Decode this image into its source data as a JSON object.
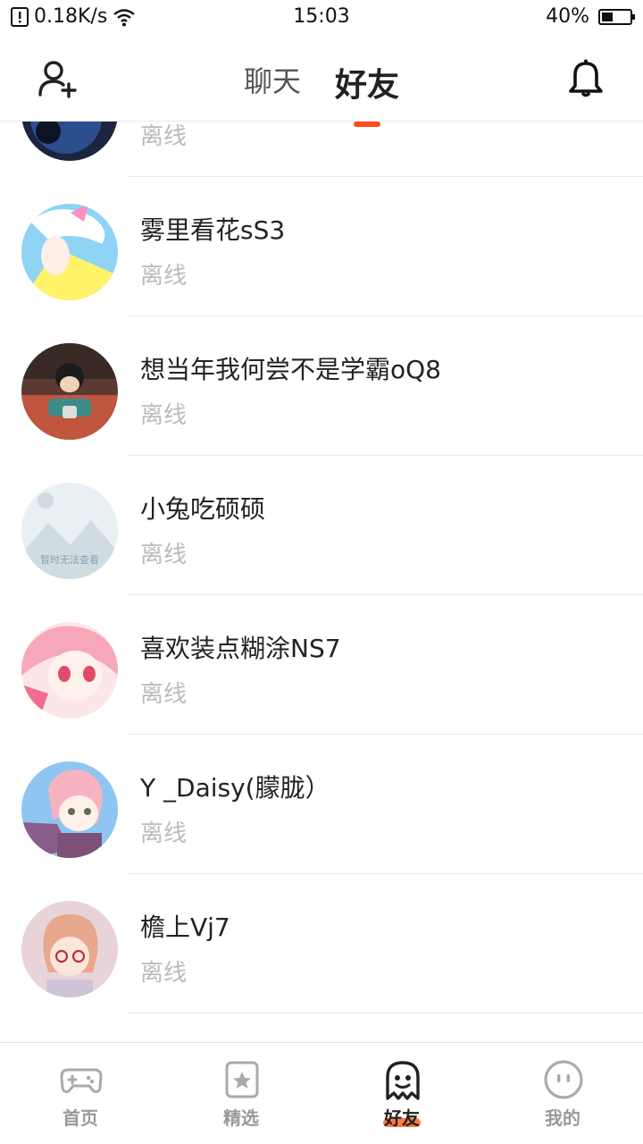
{
  "status_bar": {
    "speed": "0.18K/s",
    "time": "15:03",
    "battery": "40%",
    "battery_level": 0.4
  },
  "header": {
    "tabs": [
      {
        "label": "聊天",
        "active": false
      },
      {
        "label": "好友",
        "active": true
      }
    ],
    "add_friend_icon": "add-user-icon",
    "notification_icon": "bell-icon",
    "accent": "#ff4a1a"
  },
  "friends": [
    {
      "name": "",
      "status": "离线",
      "avatar": "galaxy"
    },
    {
      "name": "雾里看花sS3",
      "status": "离线",
      "avatar": "anime-white-hair"
    },
    {
      "name": "想当年我何尝不是学霸oQ8",
      "status": "离线",
      "avatar": "anime-boy-noodles"
    },
    {
      "name": "小兔吃硕硕",
      "status": "离线",
      "avatar": "placeholder",
      "avatar_text": "暂时无法查看"
    },
    {
      "name": "喜欢装点糊涂NS7",
      "status": "离线",
      "avatar": "anime-pink-girl"
    },
    {
      "name": "Y _Daisy(朦胧）",
      "status": "离线",
      "avatar": "anime-pink-hair"
    },
    {
      "name": "檐上Vj7",
      "status": "离线",
      "avatar": "anime-glasses-girl"
    },
    {
      "name": "",
      "status": "",
      "avatar": "colorful"
    }
  ],
  "bottom_nav": [
    {
      "label": "首页",
      "icon": "gamepad-icon",
      "active": false
    },
    {
      "label": "精选",
      "icon": "star-icon",
      "active": false
    },
    {
      "label": "好友",
      "icon": "ghost-icon",
      "active": true
    },
    {
      "label": "我的",
      "icon": "face-icon",
      "active": false
    }
  ]
}
